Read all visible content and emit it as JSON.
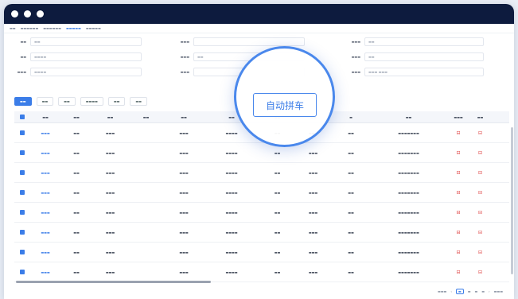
{
  "callout": {
    "label": "自动拼车"
  },
  "colors": {
    "accent": "#3b7de8",
    "titlebar": "#0d1b3e",
    "danger": "#e04848"
  }
}
